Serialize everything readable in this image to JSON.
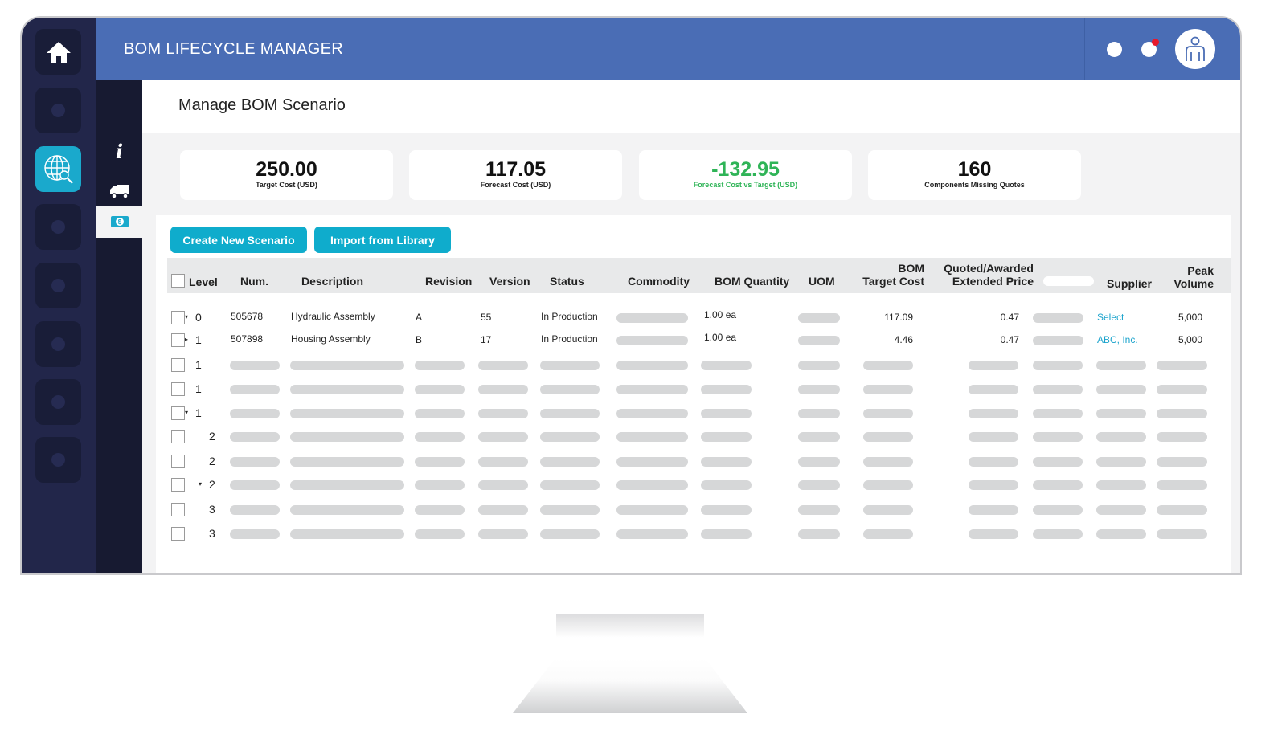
{
  "header": {
    "app_title": "BOM LIFECYCLE MANAGER",
    "icons": [
      "home-icon",
      "notification-icon",
      "alert-icon",
      "user-avatar-icon"
    ],
    "alert_badge_color": "#e8192c"
  },
  "rail": {
    "items": [
      {
        "name": "home",
        "icon": "home-icon",
        "active": false
      },
      {
        "name": "nav-2",
        "icon": "dot-icon",
        "active": false
      },
      {
        "name": "global-search",
        "icon": "globe-search-icon",
        "active": true
      },
      {
        "name": "nav-4",
        "icon": "dot-icon",
        "active": false
      },
      {
        "name": "nav-5",
        "icon": "dot-icon",
        "active": false
      },
      {
        "name": "nav-6",
        "icon": "dot-icon",
        "active": false
      },
      {
        "name": "nav-7",
        "icon": "dot-icon",
        "active": false
      },
      {
        "name": "nav-8",
        "icon": "dot-icon",
        "active": false
      }
    ],
    "accent": "#1aa9cc"
  },
  "subrail": {
    "items": [
      {
        "icon": "info-icon",
        "active": false
      },
      {
        "icon": "truck-icon",
        "active": false
      },
      {
        "icon": "money-icon",
        "active": true
      }
    ]
  },
  "page": {
    "title": "Manage BOM Scenario"
  },
  "kpis": [
    {
      "value": "250.00",
      "label": "Target Cost (USD)",
      "color": "#111111"
    },
    {
      "value": "117.05",
      "label": "Forecast Cost (USD)",
      "color": "#111111"
    },
    {
      "value": "-132.95",
      "label": "Forecast Cost vs Target (USD)",
      "color": "#2fb457"
    },
    {
      "value": "160",
      "label": "Components Missing Quotes",
      "color": "#111111"
    }
  ],
  "actions": {
    "create_label": "Create New Scenario",
    "import_label": "Import from Library",
    "button_color": "#0faccc"
  },
  "table": {
    "columns": {
      "level": "Level",
      "num": "Num.",
      "description": "Description",
      "revision": "Revision",
      "version": "Version",
      "status": "Status",
      "commodity": "Commodity",
      "bom_quantity": "BOM Quantity",
      "uom": "UOM",
      "target_cost_1": "BOM",
      "target_cost_2": "Target Cost",
      "extended_1": "Quoted/Awarded",
      "extended_2": "Extended Price",
      "supplier": "Supplier",
      "peak_1": "Peak",
      "peak_2": "Volume"
    },
    "rows": [
      {
        "level": "0",
        "caret": "▾",
        "num": "505678",
        "description": "Hydraulic Assembly",
        "revision": "A",
        "version": "55",
        "status": "In Production",
        "bom_quantity": "1.00 ea",
        "target_cost": "117.09",
        "extended_price": "0.47",
        "supplier": "Select",
        "peak_volume": "5,000"
      },
      {
        "level": "1",
        "caret": "▸",
        "num": "507898",
        "description": "Housing Assembly",
        "revision": "B",
        "version": "17",
        "status": "In Production",
        "bom_quantity": "1.00 ea",
        "target_cost": "4.46",
        "extended_price": "0.47",
        "supplier": "ABC, Inc.",
        "peak_volume": "5,000"
      },
      {
        "level": "1",
        "caret": ""
      },
      {
        "level": "1",
        "caret": ""
      },
      {
        "level": "1",
        "caret": "▾"
      },
      {
        "level": "2",
        "caret": ""
      },
      {
        "level": "2",
        "caret": ""
      },
      {
        "level": "2",
        "caret": "▾"
      },
      {
        "level": "3",
        "caret": ""
      },
      {
        "level": "3",
        "caret": ""
      }
    ]
  }
}
